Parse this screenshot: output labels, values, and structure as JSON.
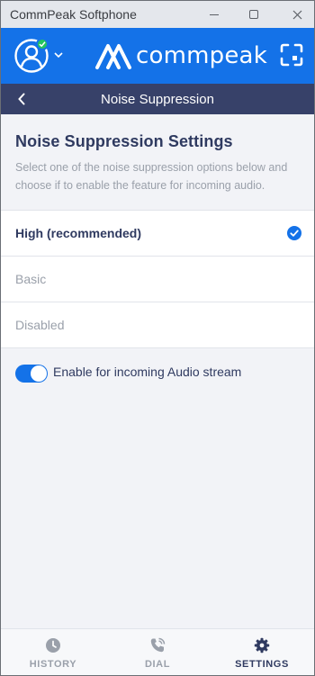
{
  "window": {
    "title": "CommPeak Softphone"
  },
  "header": {
    "brand_name": "commpeak",
    "avatar_icon": "user-circle-icon",
    "status": "online",
    "expand_icon": "expand-icon"
  },
  "navbar": {
    "title": "Noise Suppression",
    "back_icon": "chevron-left-icon"
  },
  "settings": {
    "heading": "Noise Suppression Settings",
    "description": "Select one of the noise suppression options below and choose if to enable the feature for incoming audio.",
    "options": [
      {
        "label": "High (recommended)",
        "selected": true
      },
      {
        "label": "Basic",
        "selected": false
      },
      {
        "label": "Disabled",
        "selected": false
      }
    ],
    "incoming_toggle": {
      "label": "Enable for incoming Audio stream",
      "enabled": true
    }
  },
  "tabs": [
    {
      "label": "HISTORY",
      "icon": "clock-icon",
      "active": false
    },
    {
      "label": "DIAL",
      "icon": "phone-icon",
      "active": false
    },
    {
      "label": "SETTINGS",
      "icon": "gear-icon",
      "active": true
    }
  ],
  "colors": {
    "accent": "#1472e8",
    "navbar": "#374169",
    "heading": "#2f3a60",
    "muted": "#9aa0aa",
    "status_online": "#22c55e"
  }
}
